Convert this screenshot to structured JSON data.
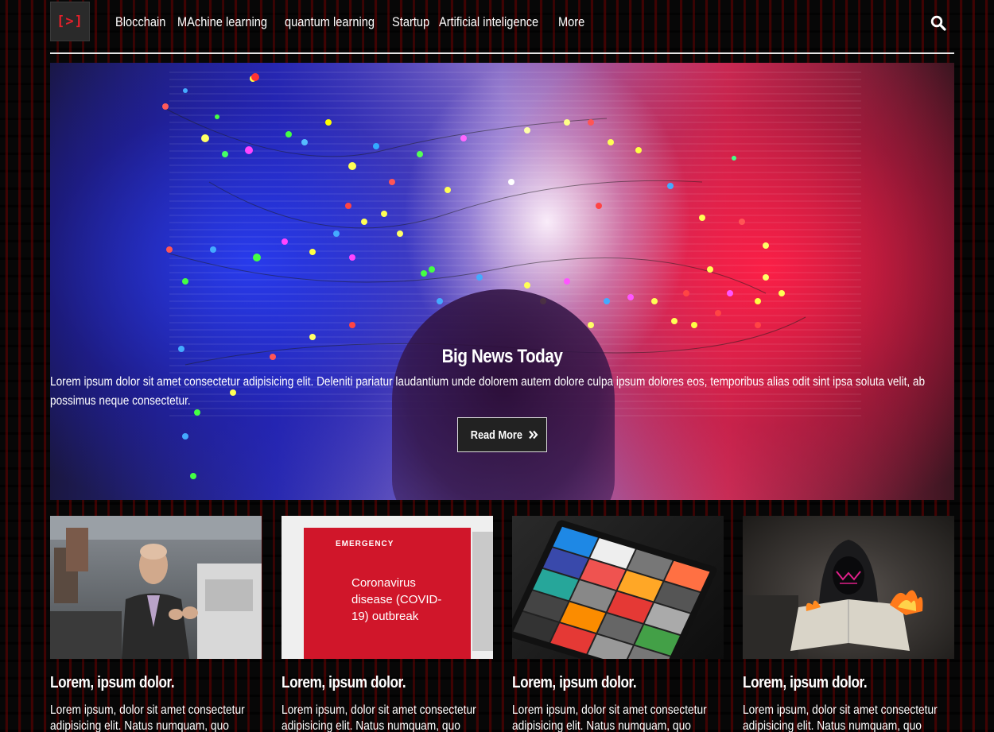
{
  "header": {
    "logo_text": "[>]",
    "nav_items": [
      "Blocchain",
      "MAchine learning",
      "quantum learning",
      "Startup",
      "Artificial inteligence",
      "More"
    ],
    "search_icon": "search-icon"
  },
  "hero": {
    "title": "Big News Today",
    "text": "Lorem ipsum dolor sit amet consectetur adipisicing elit. Deleniti pariatur laudantium unde dolorem autem dolore culpa ipsum dolores eos, temporibus alias odit sint ipsa soluta velit, ab possimus neque consectetur.",
    "button_label": "Read More",
    "button_icon": "double-chevron-right-icon"
  },
  "cards": [
    {
      "title": "Lorem, ipsum dolor.",
      "text": "Lorem ipsum, dolor sit amet consectetur adipisicing elit. Natus numquam, quo mollitia"
    },
    {
      "title": "Lorem, ipsum dolor.",
      "text": "Lorem ipsum, dolor sit amet consectetur adipisicing elit. Natus numquam, quo mollitia",
      "image_label": "EMERGENCY",
      "image_text": "Coronavirus disease (COVID-19) outbreak"
    },
    {
      "title": "Lorem, ipsum dolor.",
      "text": "Lorem ipsum, dolor sit amet consectetur adipisicing elit. Natus numquam, quo mollitia"
    },
    {
      "title": "Lorem, ipsum dolor.",
      "text": "Lorem ipsum, dolor sit amet consectetur adipisicing elit. Natus numquam, quo mollitia"
    }
  ],
  "colors": {
    "background": "#070707",
    "brand_red": "#e4202b",
    "stripe_red": "#6e0000"
  }
}
